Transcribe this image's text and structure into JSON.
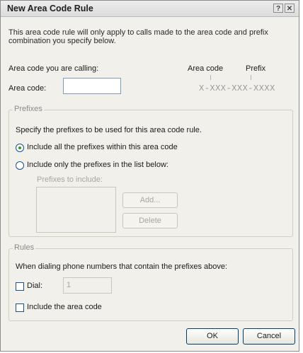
{
  "window": {
    "title": "New Area Code Rule",
    "help_glyph": "?",
    "close_glyph": "✕"
  },
  "description": "This area code rule will only apply to calls made to the area code and prefix combination you specify below.",
  "area": {
    "calling_label": "Area code you are calling:",
    "code_label": "Area code:",
    "code_value": "",
    "col_area_code": "Area code",
    "col_prefix": "Prefix",
    "format": "X-XXX-XXX-XXXX"
  },
  "prefixes": {
    "group_label": "Prefixes",
    "instruction": "Specify the prefixes to be used for this area code rule.",
    "option_all": "Include all the prefixes within this area code",
    "option_all_selected": true,
    "option_list": "Include only the prefixes in the list below:",
    "list_label": "Prefixes to include:",
    "add_button": "Add...",
    "delete_button": "Delete"
  },
  "rules": {
    "group_label": "Rules",
    "instruction": "When dialing phone numbers that contain the prefixes above:",
    "dial_label": "Dial:",
    "dial_checked": false,
    "dial_value": "1",
    "include_area_code_label": "Include the area code",
    "include_area_code_checked": false
  },
  "footer": {
    "ok_label": "OK",
    "cancel_label": "Cancel"
  }
}
